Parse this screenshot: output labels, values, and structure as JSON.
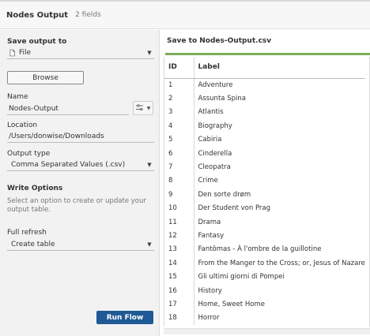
{
  "header": {
    "title": "Nodes Output",
    "fields": "2 fields"
  },
  "left": {
    "save_output_label": "Save output to",
    "save_output_value": "File",
    "browse_label": "Browse",
    "name_label": "Name",
    "name_value": "Nodes-Output",
    "location_label": "Location",
    "location_value": "/Users/donwise/Downloads",
    "output_type_label": "Output type",
    "output_type_value": "Comma Separated Values (.csv)",
    "write_options_label": "Write Options",
    "write_options_hint": "Select an option to create or update your output table.",
    "full_refresh_label": "Full refresh",
    "full_refresh_value": "Create table",
    "run_label": "Run Flow"
  },
  "preview": {
    "title": "Save to Nodes-Output.csv",
    "columns": [
      "ID",
      "Label"
    ],
    "rows": [
      [
        "1",
        "Adventure"
      ],
      [
        "2",
        "Assunta Spina"
      ],
      [
        "3",
        "Atlantis"
      ],
      [
        "4",
        "Biography"
      ],
      [
        "5",
        "Cabiria"
      ],
      [
        "6",
        "Cinderella"
      ],
      [
        "7",
        "Cleopatra"
      ],
      [
        "8",
        "Crime"
      ],
      [
        "9",
        "Den sorte drøm"
      ],
      [
        "10",
        "Der Student von Prag"
      ],
      [
        "11",
        "Drama"
      ],
      [
        "12",
        "Fantasy"
      ],
      [
        "13",
        "Fantômas - À l'ombre de la guillotine"
      ],
      [
        "14",
        "From the Manger to the Cross; or, Jesus of Nazareth"
      ],
      [
        "15",
        "Gli ultimi giorni di Pompei"
      ],
      [
        "16",
        "History"
      ],
      [
        "17",
        "Home, Sweet Home"
      ],
      [
        "18",
        "Horror"
      ]
    ]
  }
}
